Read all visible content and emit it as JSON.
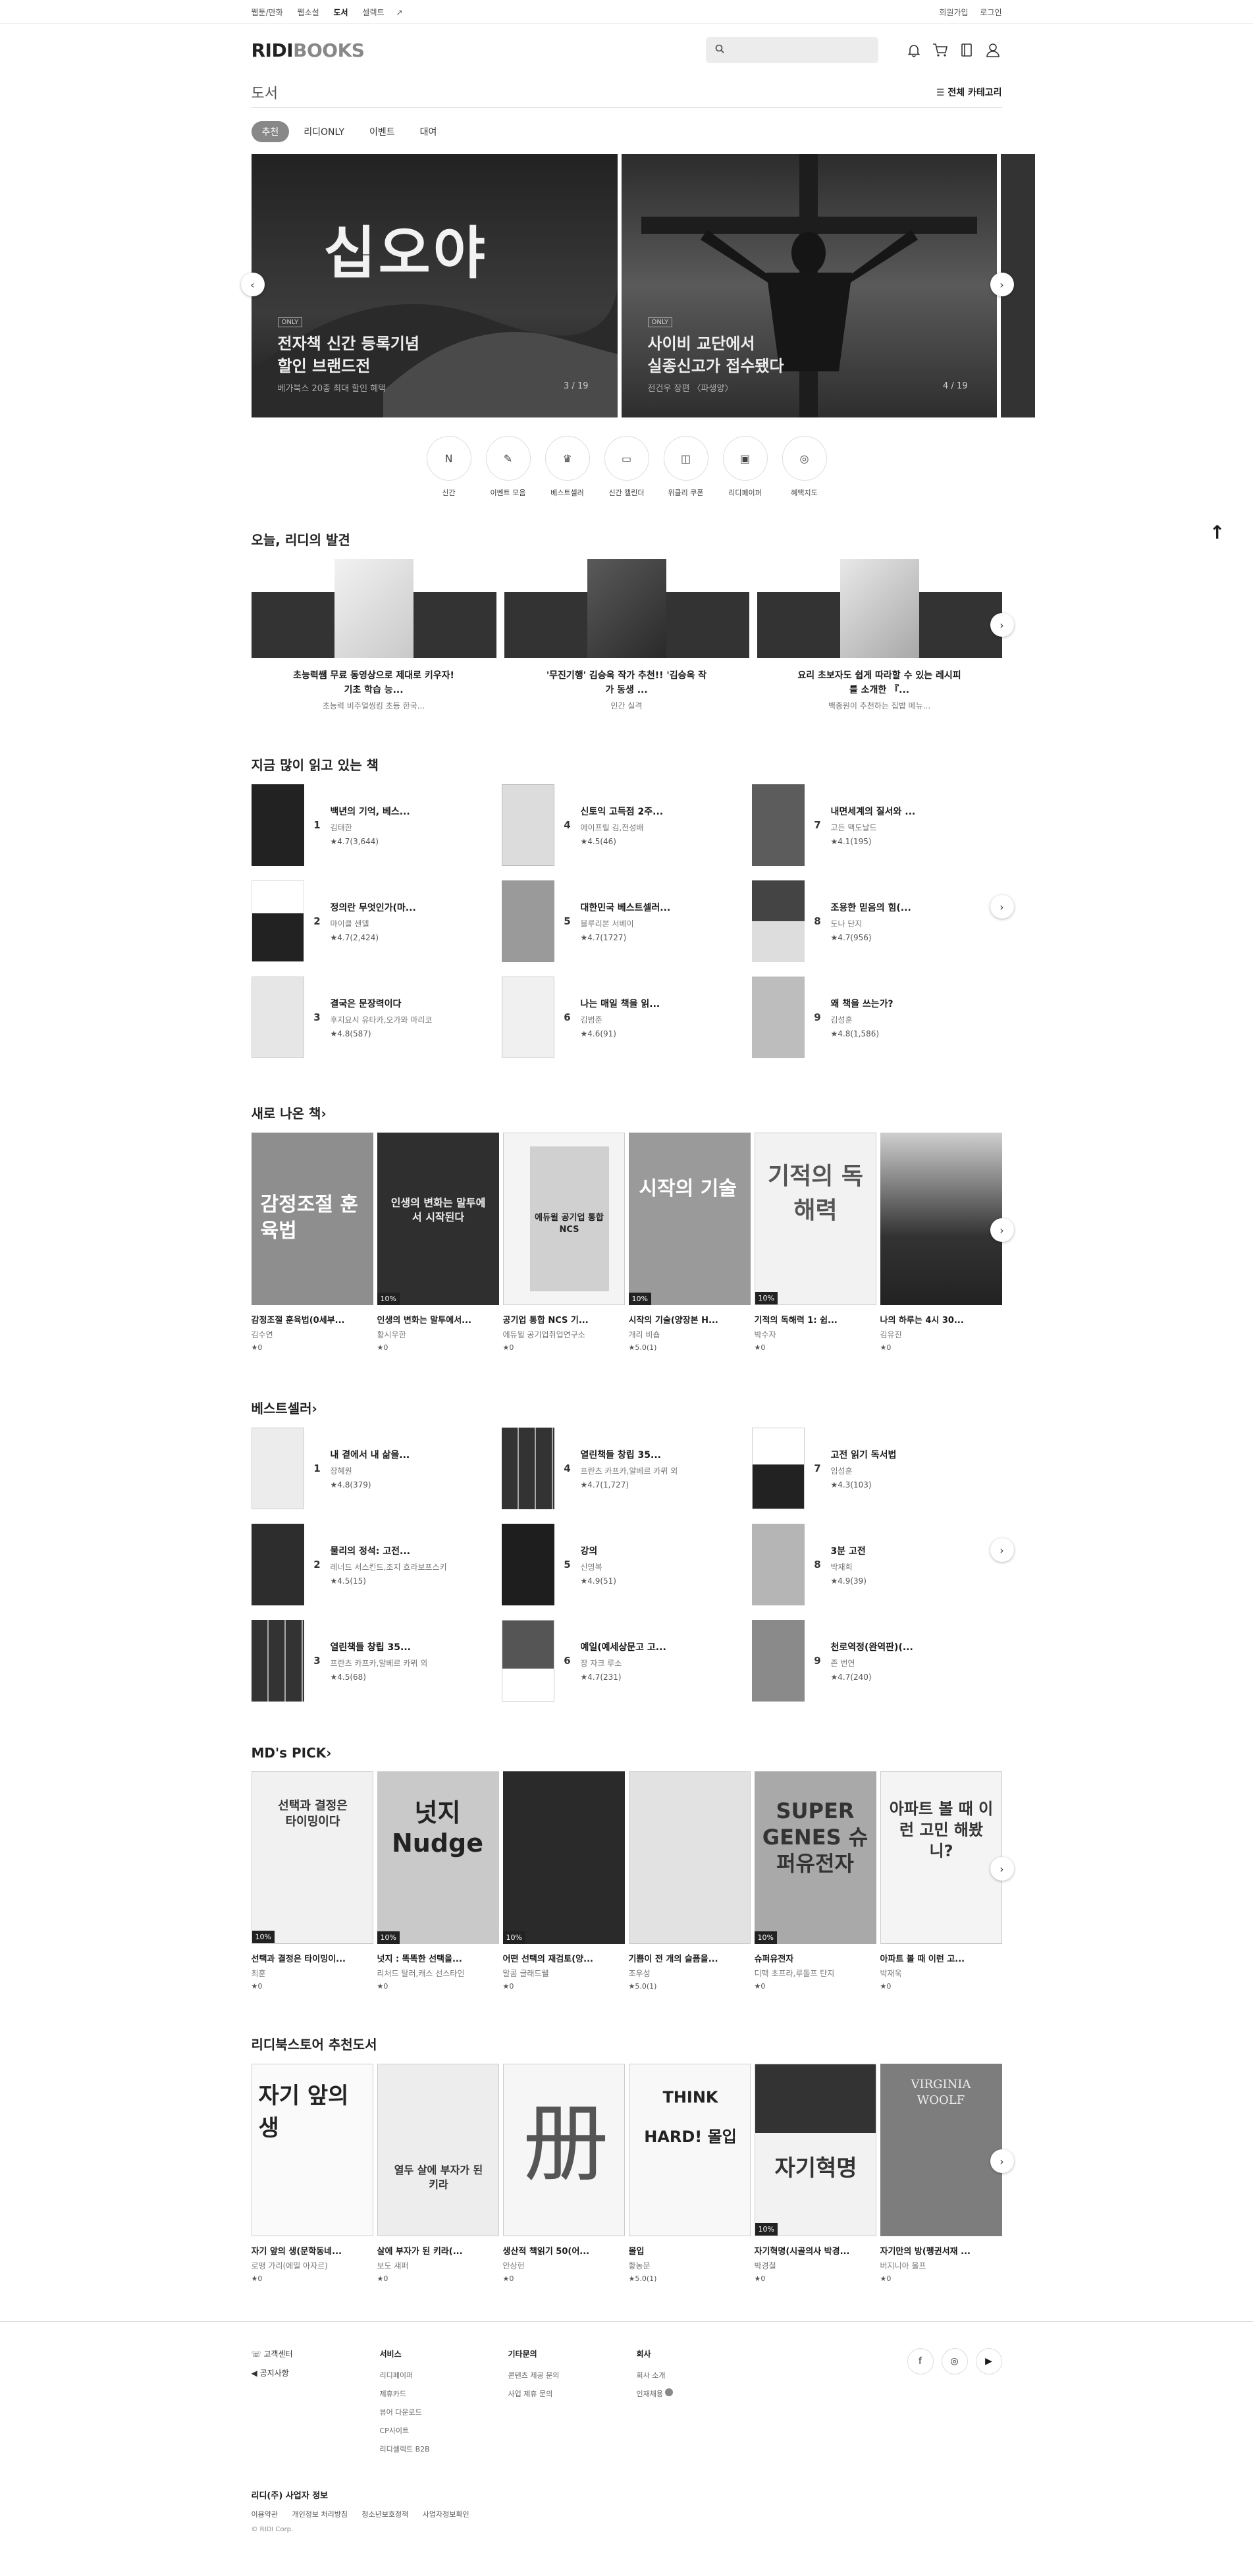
{
  "topbar": {
    "tabs": [
      "웹툰/만화",
      "웹소설",
      "도서",
      "셀렉트"
    ],
    "tabs_suffix": [
      "",
      "",
      "",
      "↗"
    ],
    "active_tab": "도서",
    "signup": "회원가입",
    "login": "로그인"
  },
  "header": {
    "logo_main": "RIDI",
    "logo_sub": "BOOKS",
    "search_icon": "search-icon",
    "search_placeholder": ""
  },
  "section": {
    "title": "도서",
    "all_categories": "☰ 전체 카테고리"
  },
  "pills": [
    "추천",
    "리디ONLY",
    "이벤트",
    "대여"
  ],
  "carousel": {
    "slides": [
      {
        "badge": "ONLY",
        "title_line1": "전자책 신간 등록기념",
        "title_line2": "할인 브랜드전",
        "sub": "베가북스 20종 최대 할인 혜택",
        "index": "3 / 19",
        "hero": "십오야"
      },
      {
        "badge": "ONLY",
        "title_line1": "사이비 교단에서",
        "title_line2": "실종신고가 접수됐다",
        "sub": "전건우 장편 〈파생양〉",
        "index": "4 / 19"
      }
    ]
  },
  "quick_menu": [
    {
      "label": "신간",
      "glyph": "N"
    },
    {
      "label": "이벤트 모음",
      "glyph": "✎"
    },
    {
      "label": "베스트셀러",
      "glyph": "♛"
    },
    {
      "label": "신간 캘린더",
      "glyph": "▭"
    },
    {
      "label": "위클리 쿠폰",
      "glyph": "◫"
    },
    {
      "label": "리디페이퍼",
      "glyph": "▣"
    },
    {
      "label": "혜택지도",
      "glyph": "◎"
    }
  ],
  "discover": {
    "title": "오늘, 리디의 발견",
    "cards": [
      {
        "title": "초능력쌤 무료 동영상으로 제대로 키우자! 기초 학습 능...",
        "sub": "초능력 비주얼씽킹 초등 한국..."
      },
      {
        "title": "'무진기행' 김승옥 작가 추천!! '김승옥 작가 동생 ...",
        "sub": "인간 실격"
      },
      {
        "title": "요리 초보자도 쉽게 따라할 수 있는 레시피를 소개한 『...",
        "sub": "백종원이 추천하는 집밥 메뉴..."
      }
    ]
  },
  "popular": {
    "title": "지금 많이 읽고 있는 책",
    "items": [
      {
        "rank": "1",
        "title": "백년의 기억, 베스...",
        "author": "김태한",
        "rating": "★4.7(3,644)"
      },
      {
        "rank": "2",
        "title": "정의란 무엇인가(마...",
        "author": "마이클 샌델",
        "rating": "★4.7(2,424)"
      },
      {
        "rank": "3",
        "title": "결국은 문장력이다",
        "author": "후지요시 유타카,오가와 마리코",
        "rating": "★4.8(587)"
      },
      {
        "rank": "4",
        "title": "신토익 고득점 2주...",
        "author": "에이프릴 김,전성배",
        "rating": "★4.5(46)"
      },
      {
        "rank": "5",
        "title": "대한민국 베스트셀러...",
        "author": "블루리본 서베이",
        "rating": "★4.7(1727)"
      },
      {
        "rank": "6",
        "title": "나는 매일 책을 읽...",
        "author": "김범준",
        "rating": "★4.6(91)"
      },
      {
        "rank": "7",
        "title": "내면세계의 질서와 ...",
        "author": "고든 맥도날드",
        "rating": "★4.1(195)"
      },
      {
        "rank": "8",
        "title": "조용한 믿음의 힘(...",
        "author": "도나 단지",
        "rating": "★4.7(956)"
      },
      {
        "rank": "9",
        "title": "왜 책을 쓰는가?",
        "author": "김성훈",
        "rating": "★4.8(1,586)"
      }
    ]
  },
  "new_books": {
    "title": "새로 나온 책",
    "items": [
      {
        "title": "감정조절 훈육법(0세부...",
        "author": "김수연",
        "rating": "★0",
        "discount": "",
        "cover_text": "감정조절 훈육법"
      },
      {
        "title": "인생의 변화는 말투에서...",
        "author": "황시우한",
        "rating": "★0",
        "discount": "10%",
        "cover_text": "인생의 변화는 말투에서 시작된다"
      },
      {
        "title": "공기업 통합 NCS 기...",
        "author": "에듀윌 공기업취업연구소",
        "rating": "★0",
        "discount": "",
        "cover_text": "에듀윌 공기업 통합 NCS"
      },
      {
        "title": "시작의 기술(양장본 H...",
        "author": "개리 비숍",
        "rating": "★5.0(1)",
        "discount": "10%",
        "cover_text": "시작의 기술"
      },
      {
        "title": "기적의 독해력 1: 쉽...",
        "author": "박수자",
        "rating": "★0",
        "discount": "10%",
        "cover_text": "기적의 독해력"
      },
      {
        "title": "나의 하루는 4시 30...",
        "author": "김유진",
        "rating": "★0",
        "discount": "",
        "cover_text": ""
      }
    ]
  },
  "bestsellers": {
    "title": "베스트셀러",
    "items": [
      {
        "rank": "1",
        "title": "내 곁에서 내 삶을...",
        "author": "장혜원",
        "rating": "★4.8(379)"
      },
      {
        "rank": "2",
        "title": "물리의 정석: 고전...",
        "author": "레너드 서스킨드,조지 흐라보프스키",
        "rating": "★4.5(15)"
      },
      {
        "rank": "3",
        "title": "열린책들 창립 35...",
        "author": "프란츠 카프카,알베르 카뮈 외",
        "rating": "★4.5(68)"
      },
      {
        "rank": "4",
        "title": "열린책들 창립 35...",
        "author": "프란츠 카프카,알베르 카뮈 외",
        "rating": "★4.7(1,727)"
      },
      {
        "rank": "5",
        "title": "강의",
        "author": "신영복",
        "rating": "★4.9(51)"
      },
      {
        "rank": "6",
        "title": "예일(예세상문고 고...",
        "author": "장 자크 루소",
        "rating": "★4.7(231)"
      },
      {
        "rank": "7",
        "title": "고전 읽기 독서법",
        "author": "임성훈",
        "rating": "★4.3(103)"
      },
      {
        "rank": "8",
        "title": "3분 고전",
        "author": "박재희",
        "rating": "★4.9(39)"
      },
      {
        "rank": "9",
        "title": "천로역정(완역판)(...",
        "author": "존 번연",
        "rating": "★4.7(240)"
      }
    ]
  },
  "md_pick": {
    "title": "MD's PICK",
    "items": [
      {
        "title": "선택과 결정은 타이밍이...",
        "author": "최훈",
        "rating": "★0",
        "discount": "10%",
        "cover_text": "선택과 결정은 타이밍이다"
      },
      {
        "title": "넛지 : 똑똑한 선택을...",
        "author": "리처드 탈러,캐스 선스타인",
        "rating": "★0",
        "discount": "10%",
        "cover_text": "넛지 Nudge"
      },
      {
        "title": "어떤 선택의 재검토(양...",
        "author": "말콤 글래드웰",
        "rating": "★0",
        "discount": "10%",
        "cover_text": ""
      },
      {
        "title": "기쁨이 전 개의 슬픔을...",
        "author": "조우성",
        "rating": "★5.0(1)",
        "discount": "",
        "cover_text": ""
      },
      {
        "title": "슈퍼유전자",
        "author": "디팩 초프라,루돌프 탄지",
        "rating": "★0",
        "discount": "10%",
        "cover_text": "SUPER GENES 슈퍼유전자"
      },
      {
        "title": "아파트 볼 때 이런 고...",
        "author": "박재욱",
        "rating": "★0",
        "discount": "",
        "cover_text": "아파트 볼 때 이런 고민 해봤니?"
      }
    ]
  },
  "ridi_recommend": {
    "title": "리디북스토어 추천도서",
    "items": [
      {
        "title": "자기 앞의 생(문학동네...",
        "author": "로맹 가리(에밀 아자르)",
        "rating": "★0",
        "discount": "",
        "cover_text": "자기 앞의 생"
      },
      {
        "title": "살에 부자가 된 키라(...",
        "author": "보도 섀퍼",
        "rating": "★0",
        "discount": "",
        "cover_text": "열두 살에 부자가 된 키라"
      },
      {
        "title": "생산적 책읽기 50(어...",
        "author": "안상헌",
        "rating": "★0",
        "discount": "",
        "cover_text": "册"
      },
      {
        "title": "몰입",
        "author": "황농문",
        "rating": "★5.0(1)",
        "discount": "",
        "cover_text": "THINK HARD! 몰입"
      },
      {
        "title": "자기혁명(시골의사 박경...",
        "author": "박경철",
        "rating": "★0",
        "discount": "10%",
        "cover_text": "자기혁명"
      },
      {
        "title": "자기만의 방(펭귄서재 ...",
        "author": "버지니아 울프",
        "rating": "★0",
        "discount": "",
        "cover_text": "VIRGINIA WOOLF"
      }
    ]
  },
  "footer": {
    "support": [
      "고객센터",
      "공지사항"
    ],
    "cols": [
      {
        "head": "서비스",
        "items": [
          "리디페이퍼",
          "제휴카드",
          "뷰어 다운로드",
          "CP사이트",
          "리디셀렉트 B2B"
        ]
      },
      {
        "head": "기타문의",
        "items": [
          "콘텐츠 제공 문의",
          "사업 제휴 문의"
        ]
      },
      {
        "head": "회사",
        "items": [
          "회사 소개",
          "인재채용"
        ]
      }
    ],
    "biz_title": "리디(주) 사업자 정보",
    "legal": [
      "이용약관",
      "개인정보 처리방침",
      "청소년보호정책",
      "사업자정보확인"
    ],
    "copyright": "© RIDI Corp."
  }
}
